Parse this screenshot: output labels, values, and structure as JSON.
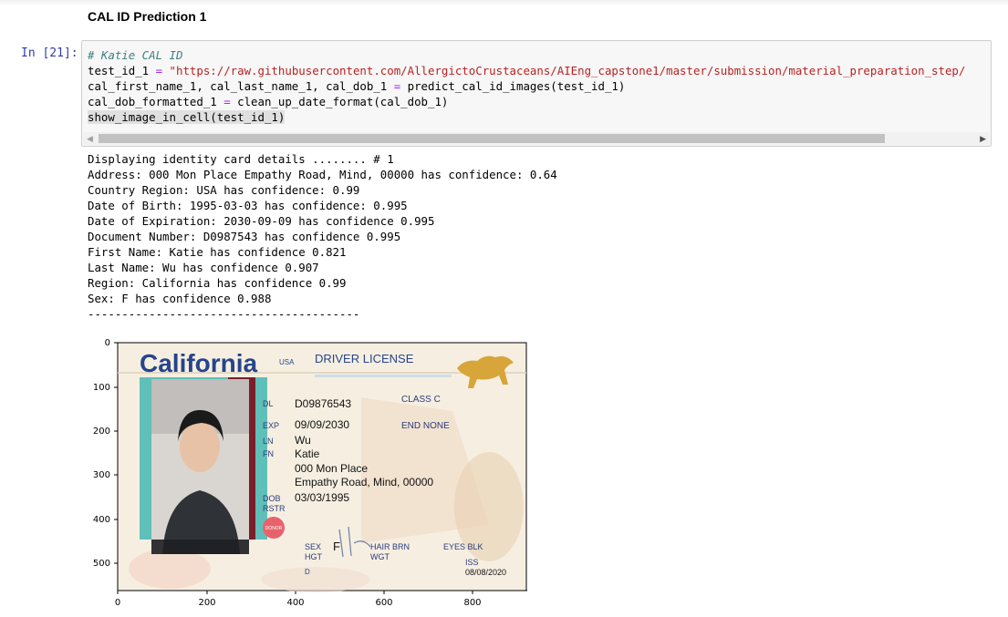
{
  "markdown": {
    "heading": "CAL ID Prediction 1"
  },
  "cell": {
    "prompt": "In [21]:",
    "code": {
      "comment": "# Katie CAL ID",
      "line2_var": "test_id_1 ",
      "line2_op": "=",
      "line2_str": " \"https://raw.githubusercontent.com/AllergictoCrustaceans/AIEng_capstone1/master/submission/material_preparation_step/",
      "line3_a": "cal_first_name_1, cal_last_name_1, cal_dob_1 ",
      "line3_op": "=",
      "line3_b": " predict_cal_id_images(test_id_1)",
      "line4_a": "cal_dob_formatted_1 ",
      "line4_op": "=",
      "line4_b": " clean_up_date_format(cal_dob_1)",
      "line5": "show_image_in_cell(test_id_1)"
    }
  },
  "output_lines": [
    "Displaying identity card details ........ # 1",
    "Address: 000 Mon Place Empathy Road, Mind, 00000 has confidence: 0.64",
    "Country Region: USA has confidence: 0.99",
    "Date of Birth: 1995-03-03 has confidence: 0.995",
    "Date of Expiration: 2030-09-09 has confidence 0.995",
    "Document Number: D0987543 has confidence 0.995",
    "First Name: Katie has confidence 0.821",
    "Last Name: Wu has confidence 0.907",
    "Region: California has confidence 0.99",
    "Sex: F has confidence 0.988",
    "----------------------------------------"
  ],
  "figure": {
    "y_ticks": [
      "0",
      "100",
      "200",
      "300",
      "400",
      "500"
    ],
    "x_ticks": [
      "0",
      "200",
      "400",
      "600",
      "800"
    ],
    "card": {
      "state": "California",
      "usa": "USA",
      "type": "DRIVER LICENSE",
      "dl_label": "DL",
      "dl_number": "D09876543",
      "class_label": "CLASS C",
      "exp_label": "EXP",
      "exp_date": "09/09/2030",
      "end_label": "END NONE",
      "ln_label": "LN",
      "last_name": "Wu",
      "fn_label": "FN",
      "first_name": "Katie",
      "address1": "000 Mon Place",
      "address2": "Empathy Road, Mind, 00000",
      "dob_label": "DOB",
      "dob": "03/03/1995",
      "rstr_label": "RSTR",
      "donor": "DONOR",
      "sex_label": "SEX",
      "sex": "F",
      "hgt_label": "HGT",
      "hair_label": "HAIR BRN",
      "wgt_label": "WGT",
      "eyes_label": "EYES BLK",
      "iss_label": "ISS",
      "iss_date": "08/08/2020",
      "dd_label": "D"
    },
    "colors": {
      "card_bg": "#f6efe1",
      "title_blue": "#27448c",
      "teal": "#5fbfb9",
      "maroon": "#7a1f2a",
      "bear_gold": "#d8a53a"
    }
  }
}
